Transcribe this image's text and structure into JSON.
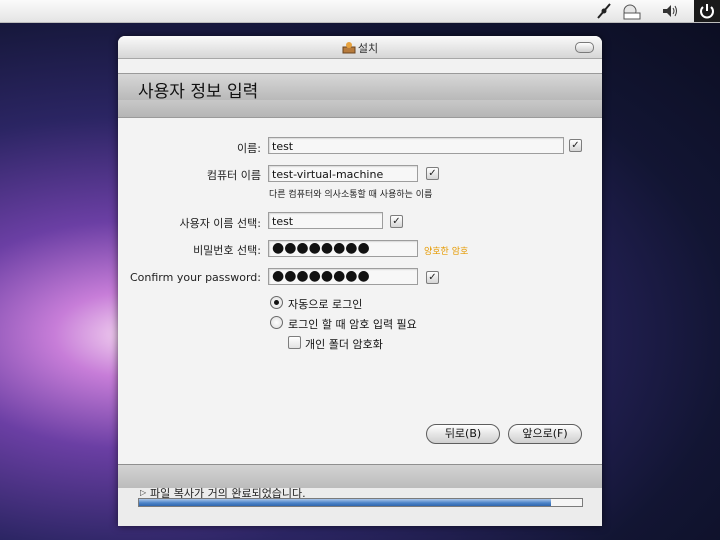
{
  "window": {
    "title": "설치",
    "page_title": "사용자 정보 입력"
  },
  "form": {
    "name_label": "이름:",
    "name_value": "test",
    "computer_label": "컴퓨터 이름",
    "computer_value": "test-virtual-machine",
    "computer_hint": "다른 컴퓨터와 의사소통할 때 사용하는 이름",
    "username_label": "사용자 이름 선택:",
    "username_value": "test",
    "password_label": "비밀번호 선택:",
    "password_mask": "●●●●●●●●",
    "password_strength": "양호한 암호",
    "confirm_label": "Confirm your password:",
    "confirm_mask": "●●●●●●●●",
    "check_mark": "✓"
  },
  "login_options": {
    "auto_login": "자동으로 로그인",
    "require_password": "로그인 할 때 암호 입력 필요",
    "encrypt_home": "개인 폴더 암호화",
    "selected": "auto_login"
  },
  "buttons": {
    "back": "뒤로(B)",
    "forward": "앞으로(F)"
  },
  "status": {
    "text": "파일 복사가 거의 완료되었습니다.",
    "progress_fraction": 0.93,
    "arrow": "▷"
  },
  "tray": {
    "icons": [
      "network-icon",
      "keyboard-indicator-icon",
      "volume-icon",
      "power-icon"
    ]
  }
}
